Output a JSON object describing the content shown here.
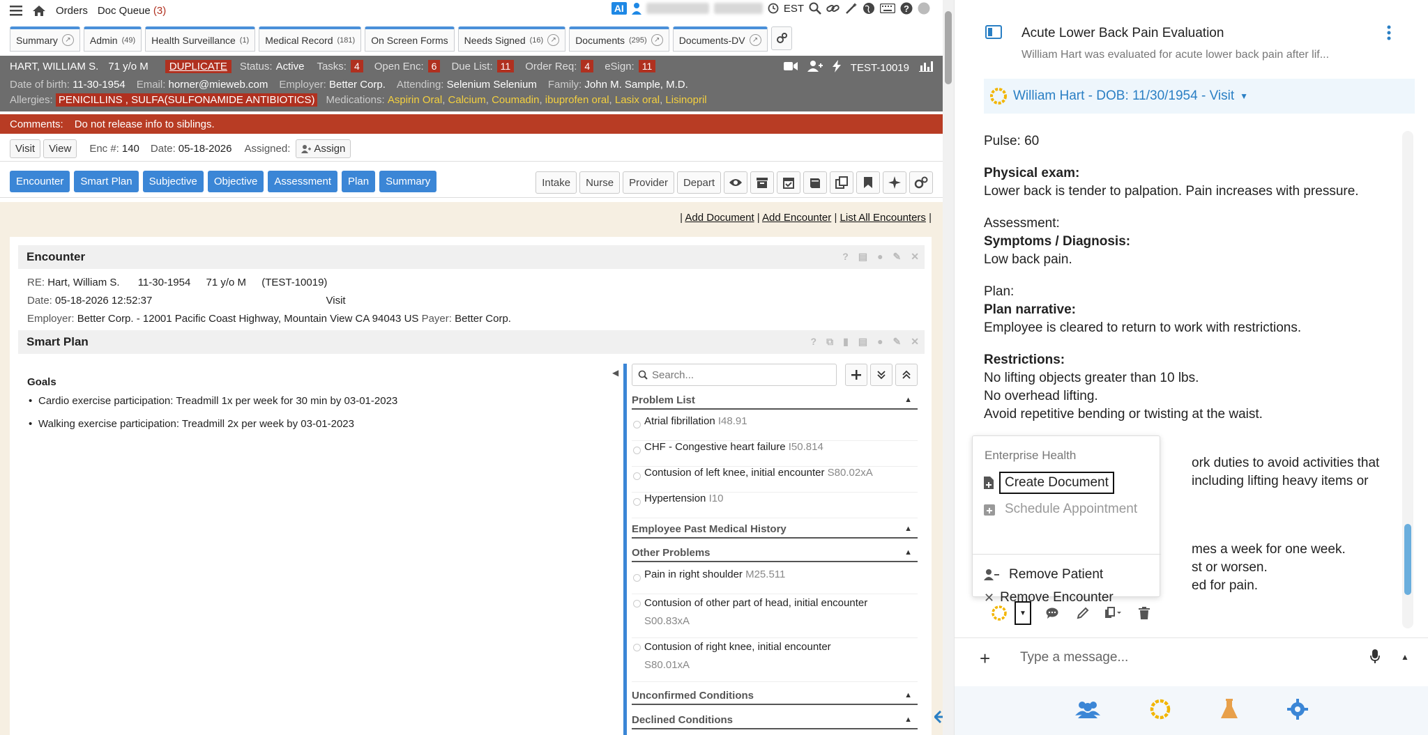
{
  "topbar": {
    "orders": "Orders",
    "doc_queue": "Doc Queue",
    "doc_queue_count": "(3)",
    "ai": "AI",
    "timezone": "EST"
  },
  "tabs": [
    {
      "label": "Summary",
      "count": ""
    },
    {
      "label": "Admin",
      "count": "(49)"
    },
    {
      "label": "Health Surveillance",
      "count": "(1)"
    },
    {
      "label": "Medical Record",
      "count": "(181)"
    },
    {
      "label": "On Screen Forms",
      "count": ""
    },
    {
      "label": "Needs Signed",
      "count": "(16)"
    },
    {
      "label": "Documents",
      "count": "(295)"
    },
    {
      "label": "Documents-DV",
      "count": ""
    }
  ],
  "patient": {
    "name": "HART, WILLIAM S.",
    "age": "71 y/o M",
    "duplicate": "DUPLICATE",
    "status_label": "Status:",
    "status": "Active",
    "tasks_label": "Tasks:",
    "tasks": "4",
    "open_enc_label": "Open Enc:",
    "open_enc": "6",
    "due_list_label": "Due List:",
    "due_list": "11",
    "order_req_label": "Order Req:",
    "order_req": "4",
    "esign_label": "eSign:",
    "esign": "11",
    "id": "TEST-10019",
    "dob_label": "Date of birth:",
    "dob": "11-30-1954",
    "email_label": "Email:",
    "email": "horner@mieweb.com",
    "employer_label": "Employer:",
    "employer": "Better Corp.",
    "attending_label": "Attending:",
    "attending": "Selenium Selenium",
    "family_label": "Family:",
    "family": "John M. Sample, M.D.",
    "allergies_label": "Allergies:",
    "allergies": "PENICILLINS , SULFA(SULFONAMIDE ANTIBIOTICS)",
    "medications_label": "Medications:",
    "medications": [
      "Aspirin Oral",
      "Calcium",
      "Coumadin",
      "ibuprofen oral",
      "Lasix oral",
      "Lisinopril"
    ],
    "comments_label": "Comments:",
    "comments": "Do not release info to siblings."
  },
  "visit": {
    "visit_btn": "Visit",
    "view_btn": "View",
    "enc_label": "Enc #:",
    "enc": "140",
    "date_label": "Date:",
    "date": "05-18-2026",
    "assigned_label": "Assigned:",
    "assign_btn": "Assign"
  },
  "sections": [
    "Encounter",
    "Smart Plan",
    "Subjective",
    "Objective",
    "Assessment",
    "Plan",
    "Summary"
  ],
  "roles": [
    "Intake",
    "Nurse",
    "Provider",
    "Depart"
  ],
  "links": {
    "add_document": "Add Document",
    "add_encounter": "Add Encounter",
    "list_all": "List All Encounters"
  },
  "encounter": {
    "title": "Encounter",
    "re_label": "RE:",
    "re_name": "Hart, William S.",
    "re_dob": "11-30-1954",
    "re_age": "71 y/o M",
    "re_id": "(TEST-10019)",
    "date_label": "Date:",
    "date": "05-18-2026 12:52:37",
    "visit": "Visit",
    "employer_label": "Employer:",
    "employer": "Better Corp. - 12001 Pacific Coast Highway, Mountain View CA 94043 US",
    "payer_label": "Payer:",
    "payer": "Better Corp."
  },
  "smart_plan": {
    "title": "Smart Plan",
    "goals_title": "Goals",
    "goals": [
      "Cardio exercise participation: Treadmill 1x per week for 30 min by 03-01-2023",
      "Walking exercise participation: Treadmill 2x per week by 03-01-2023"
    ],
    "search_placeholder": "Search...",
    "groups": {
      "problem_list": "Problem List",
      "past_history": "Employee Past Medical History",
      "other_problems": "Other Problems",
      "unconfirmed": "Unconfirmed Conditions",
      "declined": "Declined Conditions"
    },
    "problems": [
      {
        "name": "Atrial fibrillation",
        "code": "I48.91"
      },
      {
        "name": "CHF - Congestive heart failure",
        "code": "I50.814"
      },
      {
        "name": "Contusion of left knee, initial encounter",
        "code": "S80.02xA"
      },
      {
        "name": "Hypertension",
        "code": "I10"
      }
    ],
    "other": [
      {
        "name": "Pain in right shoulder",
        "code": "M25.511"
      },
      {
        "name": "Contusion of other part of head, initial encounter",
        "code": "S00.83xA"
      },
      {
        "name": "Contusion of right knee, initial encounter",
        "code": "S80.01xA"
      }
    ]
  },
  "chat": {
    "title": "Acute Lower Back Pain Evaluation",
    "subtitle": "William Hart was evaluated for acute lower back pain after lif...",
    "patient_context": "William Hart - DOB: 11/30/1954 - Visit",
    "message": {
      "pulse": "Pulse: 60",
      "pe_label": "Physical exam:",
      "pe": "Lower back is tender to palpation. Pain increases with pressure.",
      "assessment": "Assessment:",
      "sd_label": "Symptoms / Diagnosis:",
      "sd": "Low back pain.",
      "plan": "Plan:",
      "pn_label": "Plan narrative:",
      "pn": "Employee is cleared to return to work with restrictions.",
      "restr_label": "Restrictions:",
      "r1": "No lifting objects greater than 10 lbs.",
      "r2": "No overhead lifting.",
      "r3": "Avoid repetitive bending or twisting at the waist.",
      "frag1": "ork duties to avoid activities that",
      "frag2": "including lifting heavy items or",
      "frag3": "mes a week for one week.",
      "frag4": "st or worsen.",
      "frag5": "ed for pain."
    },
    "menu": {
      "header": "Enterprise Health",
      "create": "Create Document",
      "schedule": "Schedule Appointment",
      "remove_patient": "Remove Patient",
      "remove_encounter": "Remove Encounter"
    },
    "input_placeholder": "Type a message..."
  }
}
